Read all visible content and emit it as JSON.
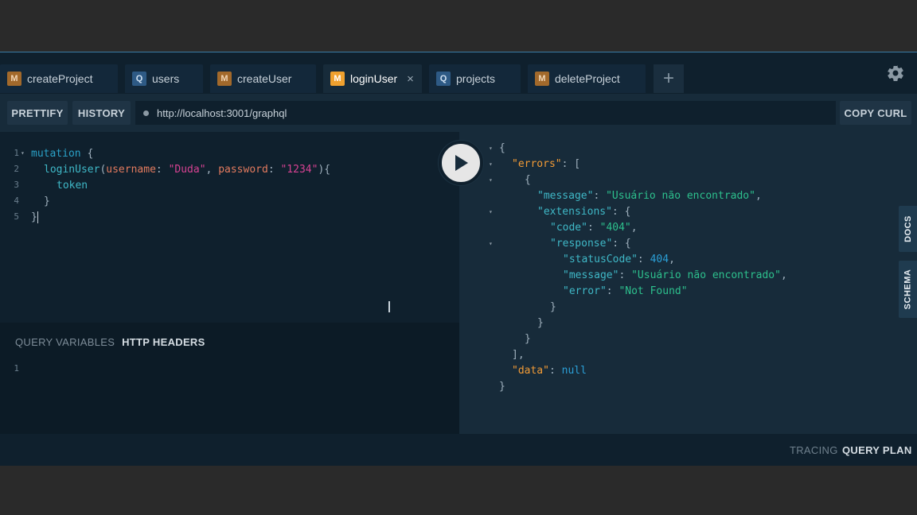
{
  "tabs": [
    {
      "type": "M",
      "label": "createProject",
      "active": false
    },
    {
      "type": "Q",
      "label": "users",
      "active": false
    },
    {
      "type": "M",
      "label": "createUser",
      "active": false
    },
    {
      "type": "M",
      "label": "loginUser",
      "active": true
    },
    {
      "type": "Q",
      "label": "projects",
      "active": false
    },
    {
      "type": "M",
      "label": "deleteProject",
      "active": false
    }
  ],
  "tab_close": "×",
  "tab_add": "+",
  "toolbar": {
    "prettify": "PRETTIFY",
    "history": "HISTORY",
    "url": "http://localhost:3001/graphql",
    "copy_curl": "COPY CURL"
  },
  "editor": {
    "line_numbers": [
      "1",
      "2",
      "3",
      "4",
      "5"
    ],
    "tokens": {
      "mutation": "mutation",
      "brace_open": " {",
      "fn": "loginUser",
      "paren_open": "(",
      "arg1": "username",
      "colon": ": ",
      "val1": "\"Duda\"",
      "comma": ", ",
      "arg2": "password",
      "val2": "\"1234\"",
      "paren_close": "){",
      "field": "token",
      "inner_close": "}",
      "outer_close": "}"
    }
  },
  "vars": {
    "query_variables": "QUERY VARIABLES",
    "http_headers": "HTTP HEADERS",
    "line_number": "1"
  },
  "result": {
    "errors_key": "\"errors\"",
    "message_key": "\"message\"",
    "message_val": "\"Usuário não encontrado\"",
    "extensions_key": "\"extensions\"",
    "code_key": "\"code\"",
    "code_val": "\"404\"",
    "response_key": "\"response\"",
    "status_key": "\"statusCode\"",
    "status_val": "404",
    "resp_message_key": "\"message\"",
    "resp_message_val": "\"Usuário não encontrado\"",
    "error_key": "\"error\"",
    "error_val": "\"Not Found\"",
    "data_key": "\"data\"",
    "data_val": "null"
  },
  "side_tabs": {
    "docs": "DOCS",
    "schema": "SCHEMA"
  },
  "footer": {
    "tracing": "TRACING",
    "query_plan": "QUERY PLAN"
  },
  "colors": {
    "accent": "#f0a12f",
    "background": "#0f202d"
  }
}
